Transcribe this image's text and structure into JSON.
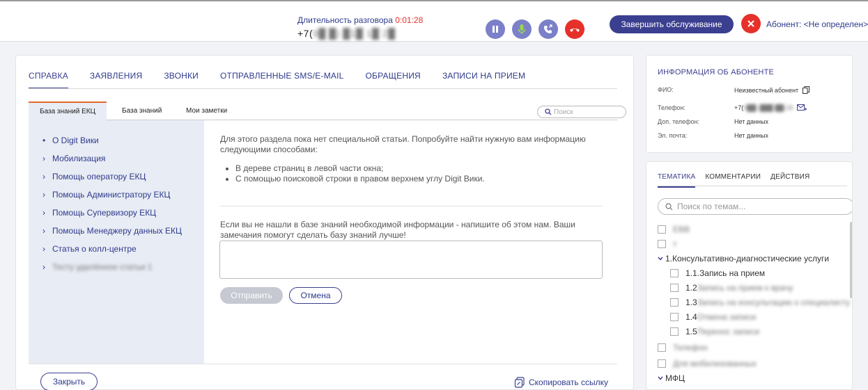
{
  "call": {
    "duration_label": "Длительность разговора",
    "duration_time": "0:01:28",
    "phone_prefix": "+7(",
    "phone_hidden": "9█ █) █1█ 1█ 2█"
  },
  "header": {
    "finish_button": "Завершить обслуживание",
    "subscriber": "Абонент: <Не определен>"
  },
  "tabs": [
    "СПРАВКА",
    "ЗАЯВЛЕНИЯ",
    "ЗВОНКИ",
    "ОТПРАВЛЕННЫЕ SMS/E-MAIL",
    "ОБРАЩЕНИЯ",
    "ЗАПИСИ НА ПРИЕМ"
  ],
  "subtabs": [
    "База знаний ЕКЦ",
    "База знаний",
    "Мои заметки"
  ],
  "search_placeholder": "Поиск",
  "sidebar": [
    {
      "bullet": "•",
      "label": "О Digit Вики"
    },
    {
      "bullet": "›",
      "label": "Мобилизация"
    },
    {
      "bullet": "›",
      "label": "Помощь оператору ЕКЦ"
    },
    {
      "bullet": "›",
      "label": "Помощь Администратору ЕКЦ"
    },
    {
      "bullet": "›",
      "label": "Помощь Супервизору ЕКЦ"
    },
    {
      "bullet": "›",
      "label": "Помощь Менеджеру данных ЕКЦ"
    },
    {
      "bullet": "›",
      "label": "Статья о колл-центре"
    },
    {
      "bullet": "›",
      "label": "Тесту удалённое статьи 1"
    }
  ],
  "article": {
    "intro": "Для этого раздела пока нет специальной статьи. Попробуйте найти нужную вам информацию следующими способами:",
    "ways": [
      "В дереве страниц в левой части окна;",
      "С помощью поисковой строки в правом верхнем углу Digit Вики."
    ],
    "feedback": "Если вы не нашли в базе знаний необходимой информации - напишите об этом нам. Ваши замечания помогут сделать базу знаний лучше!",
    "send_button": "Отправить",
    "cancel_button": "Отмена"
  },
  "footer": {
    "close_button": "Закрыть",
    "copy_link": "Скопировать ссылку"
  },
  "subscriber_info": {
    "title": "ИНФОРМАЦИЯ ОБ АБОНЕНТЕ",
    "rows": [
      {
        "label": "ФИО:",
        "value": "Неизвестный абонент"
      },
      {
        "label": "Телефон:",
        "value": "+7(",
        "hidden": "9██) ███-██-28"
      },
      {
        "label": "Доп. телефон:",
        "value": "Нет данных"
      },
      {
        "label": "Эл. почта:",
        "value": "Нет данных"
      }
    ]
  },
  "right_tabs": [
    "ТЕМАТИКА",
    "КОММЕНТАРИИ",
    "ДЕЙСТВИЯ"
  ],
  "theme_search_placeholder": "Поиск по темам...",
  "themes": {
    "item_0": "ЕВВ",
    "item_1": "т",
    "group_1": "1.Консультативно-диагностические услуги",
    "sub_1": "1.1.Запись на прием",
    "sub_2": "1.2",
    "sub_2_hidden": "Запись на прием к врачу",
    "sub_3": "1.3",
    "sub_3_hidden": "Запись на консультацию к специалисту",
    "sub_4": "1.4",
    "sub_4_hidden": "Отмена записи",
    "sub_5": "1.5",
    "sub_5_hidden": "Перенос записи",
    "item_2": "Телефон",
    "item_3": "Для мобилизованных",
    "group_2": "МФЦ"
  },
  "colors": {
    "accent": "#3b3f8f",
    "danger": "#e6312b",
    "active_tab_marker": "#e26a2c"
  }
}
